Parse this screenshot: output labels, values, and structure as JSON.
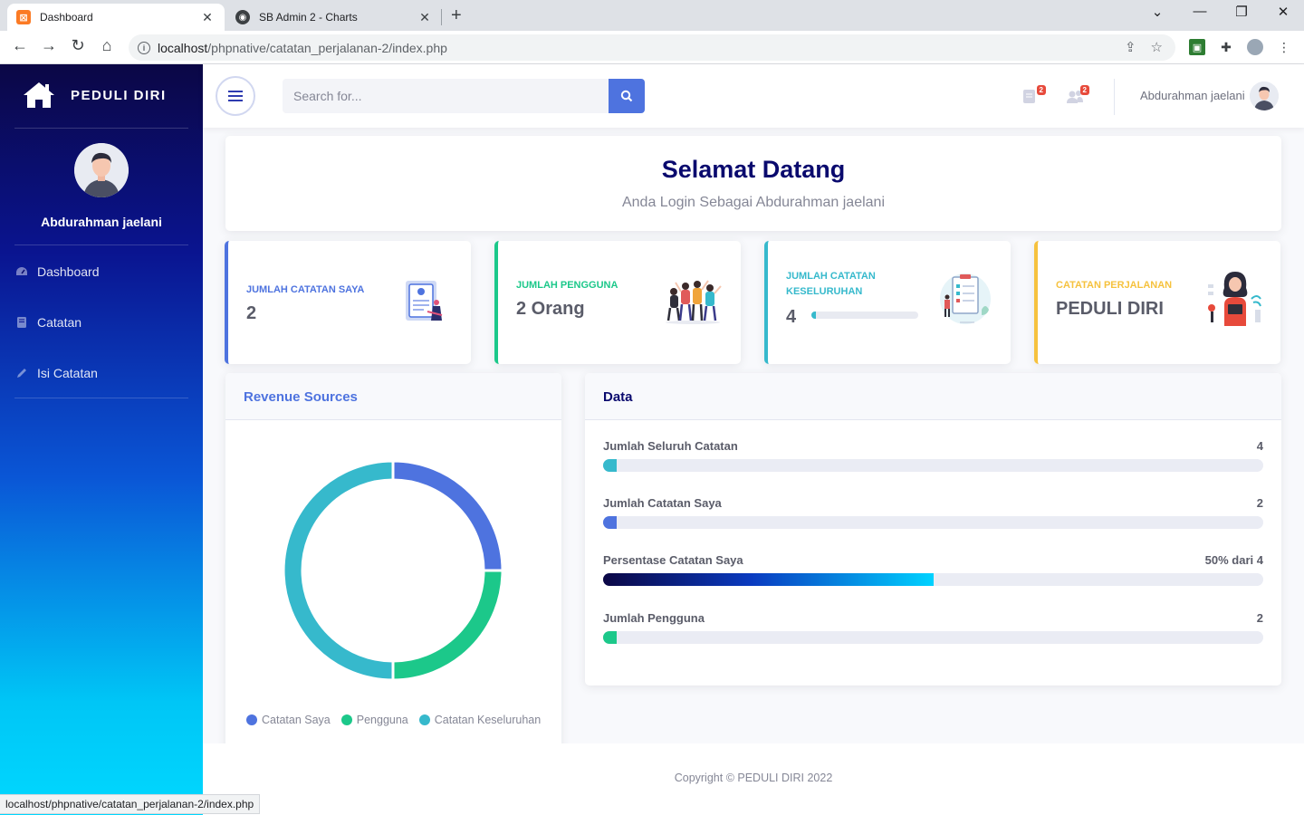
{
  "browser": {
    "tabs": [
      {
        "title": "Dashboard",
        "active": true
      },
      {
        "title": "SB Admin 2 - Charts",
        "active": false
      }
    ],
    "url_host": "localhost",
    "url_path": "/phpnative/catatan_perjalanan-2/index.php",
    "status_url": "localhost/phpnative/catatan_perjalanan-2/index.php"
  },
  "sidebar": {
    "brand": "PEDULI DIRI",
    "user": "Abdurahman jaelani",
    "items": [
      {
        "label": "Dashboard",
        "icon": "tachometer-icon"
      },
      {
        "label": "Catatan",
        "icon": "book-icon"
      },
      {
        "label": "Isi Catatan",
        "icon": "pencil-icon"
      }
    ]
  },
  "topbar": {
    "search_placeholder": "Search for...",
    "notes_badge": "2",
    "users_badge": "2",
    "user_name": "Abdurahman jaelani"
  },
  "welcome": {
    "title": "Selamat Datang",
    "subtitle": "Anda Login Sebagai Abdurahman jaelani"
  },
  "stats": [
    {
      "label": "Jumlah Catatan Saya",
      "value": "2",
      "color": "#4e73df"
    },
    {
      "label": "Jumlah Pengguna",
      "value": "2 Orang",
      "color": "#1cc88a"
    },
    {
      "label": "Jumlah Catatan Keseluruhan",
      "value": "4",
      "color": "#36b9cc",
      "progress": 0.04
    },
    {
      "label": "Catatan Perjalanan",
      "value": "PEDULI DIRI",
      "color": "#f6c23e"
    }
  ],
  "revenue_card": {
    "title": "Revenue Sources",
    "legend": [
      {
        "label": "Catatan Saya",
        "color": "#4e73df"
      },
      {
        "label": "Pengguna",
        "color": "#1cc88a"
      },
      {
        "label": "Catatan Keseluruhan",
        "color": "#36b9cc"
      }
    ]
  },
  "chart_data": {
    "type": "pie",
    "donut": true,
    "categories": [
      "Catatan Saya",
      "Pengguna",
      "Catatan Keseluruhan"
    ],
    "values": [
      2,
      2,
      4
    ],
    "colors": [
      "#4e73df",
      "#1cc88a",
      "#36b9cc"
    ],
    "legend": "bottom"
  },
  "data_card": {
    "title": "Data",
    "rows": [
      {
        "label": "Jumlah Seluruh Catatan",
        "value": "4",
        "fraction": 0.02,
        "color": "#36b9cc"
      },
      {
        "label": "Jumlah Catatan Saya",
        "value": "2",
        "fraction": 0.02,
        "color": "#4e73df"
      },
      {
        "label": "Persentase Catatan Saya",
        "value": "50% dari 4",
        "fraction": 0.5,
        "color": "linear-gradient(90deg, #0b0745 0%, #0a3bc0 45%, #00d2ff 100%)"
      },
      {
        "label": "Jumlah Pengguna",
        "value": "2",
        "fraction": 0.02,
        "color": "#1cc88a"
      }
    ]
  },
  "footer": {
    "text": "Copyright © PEDULI DIRI 2022"
  }
}
